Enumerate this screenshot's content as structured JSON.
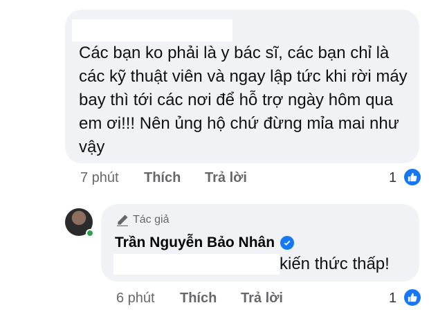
{
  "comments": [
    {
      "text": "Các bạn ko phải là y bác sĩ, các bạn chỉ là các kỹ thuật viên và ngay lập tức khi rời máy bay thì tới các nơi để hỗ trợ ngày hôm qua em ơi!!! Nên ủng hộ chứ đừng mỉa mai như vậy",
      "time": "7 phút",
      "like_label": "Thích",
      "reply_label": "Trả lời",
      "like_count": "1"
    },
    {
      "author_badge": "Tác giả",
      "author_name": "Trần Nguyễn Bảo Nhân",
      "text": "kiến thức thấp!",
      "time": "6 phút",
      "like_label": "Thích",
      "reply_label": "Trả lời",
      "like_count": "1"
    }
  ],
  "colors": {
    "bubble": "#f0f2f5",
    "facebook_blue": "#1877f2",
    "online_green": "#31a24c",
    "secondary_text": "#65676b"
  },
  "icons": [
    "like-thumb-icon",
    "pencil-icon",
    "verified-check-icon"
  ]
}
